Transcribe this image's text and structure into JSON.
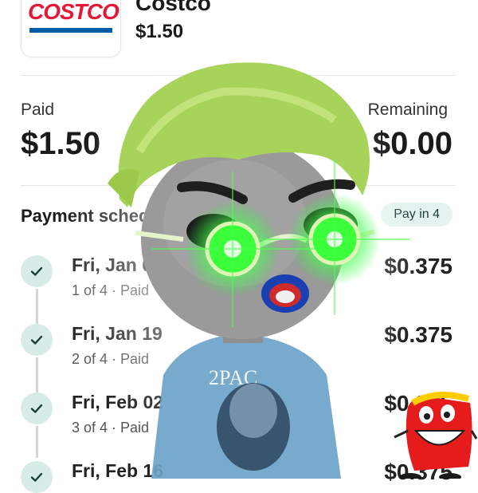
{
  "merchant": {
    "logo_text": "COSTCO",
    "name": "Costco",
    "amount": "$1.50"
  },
  "summary": {
    "paid_label": "Paid",
    "paid_value": "$1.50",
    "remaining_label": "Remaining",
    "remaining_value": "$0.00"
  },
  "schedule": {
    "title": "Payment schedule",
    "badge": "Pay in 4",
    "items": [
      {
        "date": "Fri, Jan 05",
        "status": "1 of 4 · Paid",
        "amount": "$0.375"
      },
      {
        "date": "Fri, Jan 19",
        "status": "2 of 4 · Paid",
        "amount": "$0.375"
      },
      {
        "date": "Fri, Feb 02",
        "status": "3 of 4 · Paid",
        "amount": "$0.375"
      },
      {
        "date": "Fri, Feb 16",
        "status": "",
        "amount": "$0.375"
      }
    ]
  },
  "stickers": {
    "avatar_shirt_text": "2PAC",
    "icons": [
      "cartoon-avatar-sticker",
      "happy-meal-box-sticker"
    ]
  },
  "colors": {
    "accent_check_bg": "#d7ece7",
    "check_mark": "#1b3d35",
    "badge_bg": "#e4f3ef",
    "brand_red": "#e31837",
    "brand_blue": "#005daa",
    "glow_green": "#22ff33"
  }
}
